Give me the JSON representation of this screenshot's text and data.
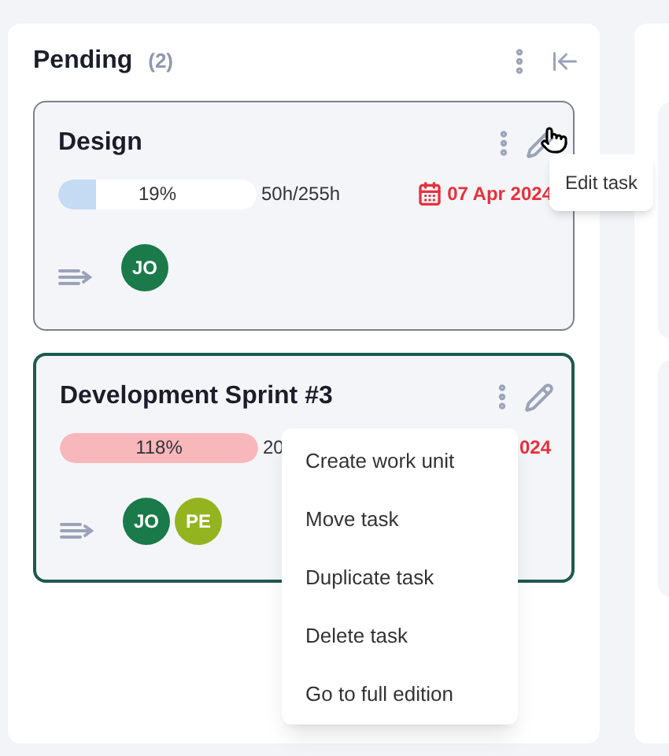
{
  "column": {
    "title": "Pending",
    "count": "(2)"
  },
  "cards": [
    {
      "title": "Design",
      "selected": false,
      "progress": {
        "level": 0.19,
        "label": "19%",
        "color": "#c5daf3"
      },
      "hours": "50h/255h",
      "date": "07 Apr 2024",
      "date_icon": true,
      "assignees": [
        {
          "initials": "JO",
          "color": "#1a7a4a"
        }
      ]
    },
    {
      "title": "Development Sprint #3",
      "selected": true,
      "progress": {
        "level": 1,
        "label": "118%",
        "color": "#f8b7bb"
      },
      "hours": "20",
      "date": "024",
      "date_icon": false,
      "assignees": [
        {
          "initials": "JO",
          "color": "#1a7a4a"
        },
        {
          "initials": "PE",
          "color": "#93b41f"
        }
      ]
    }
  ],
  "tooltip": {
    "text": "Edit task"
  },
  "menu": {
    "items": [
      "Create work unit",
      "Move task",
      "Duplicate task",
      "Delete task",
      "Go to full edition"
    ]
  }
}
